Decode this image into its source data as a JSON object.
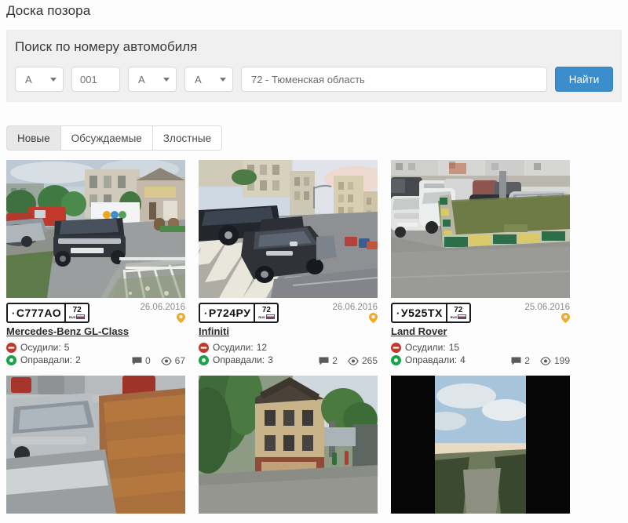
{
  "page": {
    "title": "Доска позора"
  },
  "search": {
    "heading": "Поиск по номеру автомобиля",
    "letter1": "А",
    "digits": "001",
    "letter2": "А",
    "letter3": "А",
    "region": "72 - Тюменская область",
    "find_label": "Найти",
    "accent_color": "#3b8ecb"
  },
  "tabs": [
    {
      "label": "Новые",
      "active": true
    },
    {
      "label": "Обсуждаемые",
      "active": false
    },
    {
      "label": "Злостные",
      "active": false
    }
  ],
  "labels": {
    "condemned": "Осудили:",
    "justified": "Оправдали:"
  },
  "cards": [
    {
      "plate_letter_first": "С",
      "plate_digits": "777",
      "plate_letters_last": "АО",
      "plate_region": "72",
      "plate_rus": "RUS",
      "date": "26.06.2016",
      "title": "Mercedes-Benz GL-Class",
      "condemned": "5",
      "justified": "2",
      "comments": "0",
      "views": "67"
    },
    {
      "plate_letter_first": "Р",
      "plate_digits": "724",
      "plate_letters_last": "РУ",
      "plate_region": "72",
      "plate_rus": "RUS",
      "date": "26.06.2016",
      "title": "Infiniti",
      "condemned": "12",
      "justified": "3",
      "comments": "2",
      "views": "265"
    },
    {
      "plate_letter_first": "У",
      "plate_digits": "525",
      "plate_letters_last": "ТХ",
      "plate_region": "72",
      "plate_rus": "RUS",
      "date": "25.06.2016",
      "title": "Land Rover",
      "condemned": "15",
      "justified": "4",
      "comments": "2",
      "views": "199"
    }
  ],
  "colors": {
    "condemn_icon": "#c0392b",
    "justify_icon": "#16a34a",
    "pin_icon": "#f0a92b",
    "panel_bg": "#f0f0f0"
  }
}
